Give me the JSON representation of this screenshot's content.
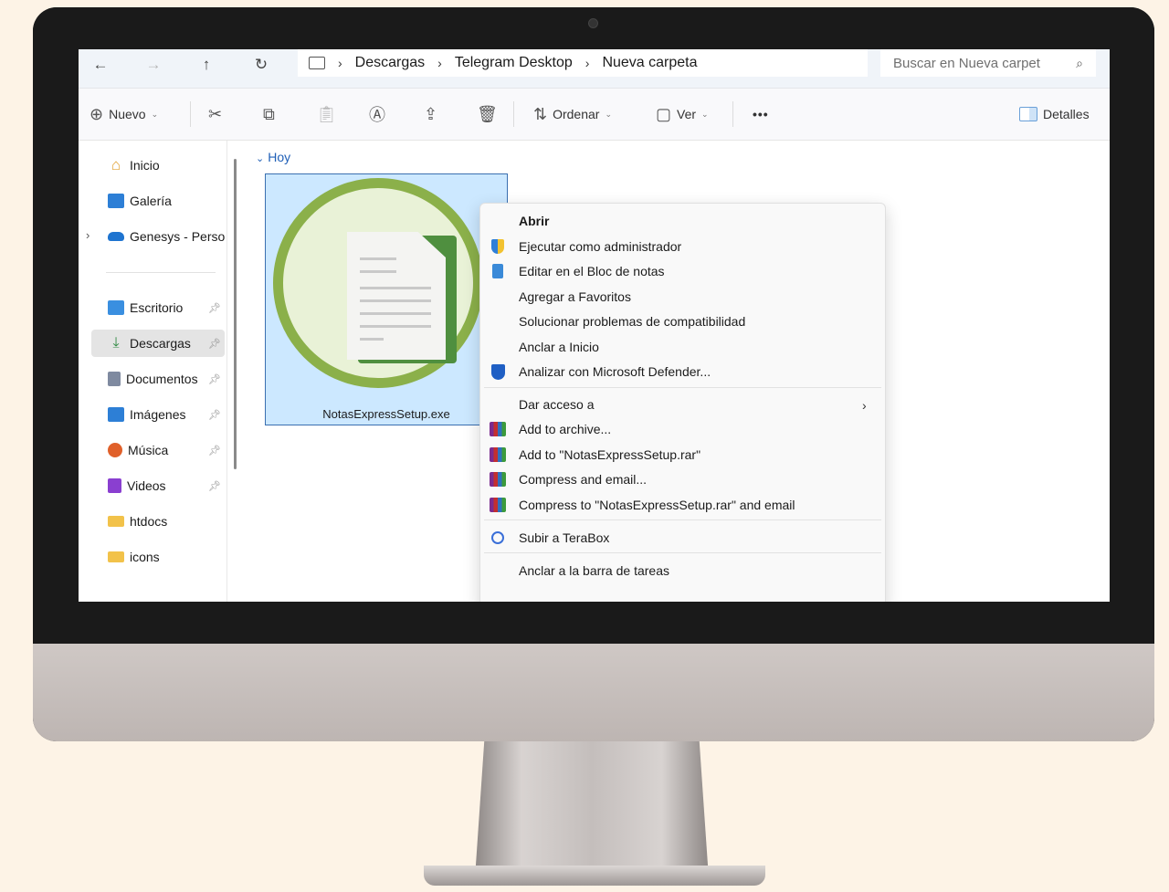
{
  "address_bar": {
    "back_icon": "arrow-left-icon",
    "forward_icon": "arrow-right-icon",
    "up_icon": "arrow-up-icon",
    "refresh_icon": "refresh-icon",
    "breadcrumbs": [
      "Descargas",
      "Telegram Desktop",
      "Nueva carpeta"
    ],
    "search_placeholder": "Buscar en Nueva carpet"
  },
  "toolbar": {
    "new_label": "Nuevo",
    "sort_label": "Ordenar",
    "view_label": "Ver",
    "more_label": "•••",
    "details_label": "Detalles"
  },
  "sidebar": {
    "top_items": [
      {
        "label": "Inicio",
        "icon": "home-icon",
        "color": "#e0a030"
      },
      {
        "label": "Galería",
        "icon": "gallery-icon",
        "color": "#2d7fd6"
      },
      {
        "label": "Genesys - Persor",
        "icon": "cloud-icon",
        "color": "#1e74d0"
      }
    ],
    "pinned_items": [
      {
        "label": "Escritorio",
        "icon": "desktop-icon",
        "color": "#3a8fe0"
      },
      {
        "label": "Descargas",
        "icon": "download-icon",
        "color": "#2f8a43"
      },
      {
        "label": "Documentos",
        "icon": "documents-icon",
        "color": "#7f8aa0"
      },
      {
        "label": "Imágenes",
        "icon": "pictures-icon",
        "color": "#2d7fd6"
      },
      {
        "label": "Música",
        "icon": "music-icon",
        "color": "#e0602a"
      },
      {
        "label": "Videos",
        "icon": "videos-icon",
        "color": "#8a3fd0"
      },
      {
        "label": "htdocs",
        "icon": "folder-icon",
        "color": "#f2c24a"
      },
      {
        "label": "icons",
        "icon": "folder-icon",
        "color": "#f2c24a"
      }
    ]
  },
  "content": {
    "group_label": "Hoy",
    "file_name": "NotasExpressSetup.exe"
  },
  "context_menu": {
    "items": [
      {
        "label": "Abrir"
      },
      {
        "label": "Ejecutar como administrador",
        "icon": "shield-icon"
      },
      {
        "label": "Editar en el Bloc de notas",
        "icon": "notepad-icon"
      },
      {
        "label": "Agregar a Favoritos"
      },
      {
        "label": "Solucionar problemas de compatibilidad"
      },
      {
        "label": "Anclar a Inicio"
      },
      {
        "label": "Analizar con Microsoft Defender...",
        "icon": "defender-icon"
      },
      {
        "label": "Dar acceso a"
      },
      {
        "label": "Add to archive...",
        "icon": "winrar-icon"
      },
      {
        "label": "Add to \"NotasExpressSetup.rar\"",
        "icon": "winrar-icon"
      },
      {
        "label": "Compress and email...",
        "icon": "winrar-icon"
      },
      {
        "label": "Compress to \"NotasExpressSetup.rar\" and email",
        "icon": "winrar-icon"
      },
      {
        "label": "Subir a TeraBox",
        "icon": "terabox-icon"
      },
      {
        "label": "Anclar a la barra de tareas"
      }
    ]
  }
}
